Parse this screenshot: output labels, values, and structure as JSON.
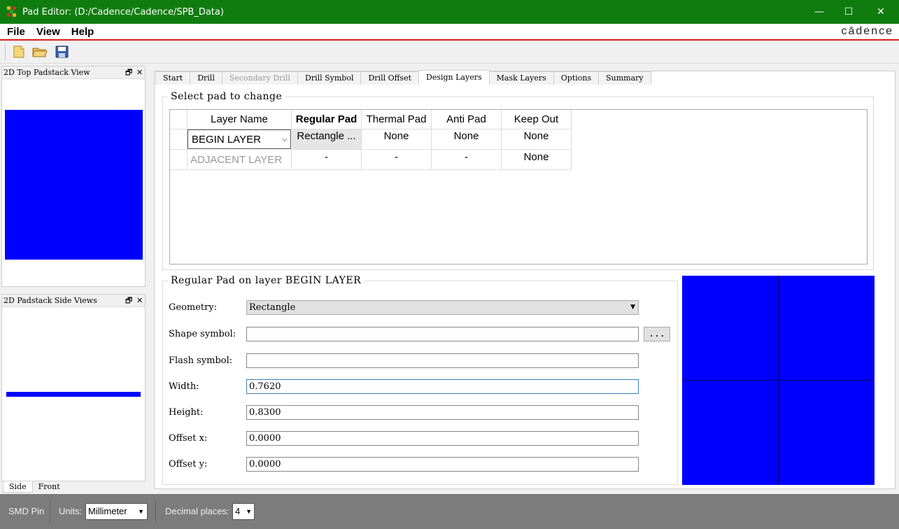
{
  "window": {
    "title": "Pad Editor:  (D:/Cadence/Cadence/SPB_Data)",
    "minimize": "—",
    "maximize": "☐",
    "close": "✕"
  },
  "menu": {
    "file": "File",
    "view": "View",
    "help": "Help",
    "brand": "cādence"
  },
  "panels": {
    "top_view_title": "2D Top Padstack View",
    "side_view_title": "2D Padstack Side Views",
    "float_glyph": "🗗",
    "close_glyph": "✕",
    "side_tab": "Side",
    "front_tab": "Front"
  },
  "tabs": [
    {
      "label": "Start"
    },
    {
      "label": "Drill"
    },
    {
      "label": "Secondary Drill"
    },
    {
      "label": "Drill Symbol"
    },
    {
      "label": "Drill Offset"
    },
    {
      "label": "Design Layers"
    },
    {
      "label": "Mask Layers"
    },
    {
      "label": "Options"
    },
    {
      "label": "Summary"
    }
  ],
  "select_pad": {
    "title": "Select pad to change",
    "columns": [
      "Layer Name",
      "Regular Pad",
      "Thermal Pad",
      "Anti Pad",
      "Keep Out"
    ],
    "rows": [
      {
        "layer": "BEGIN LAYER",
        "regular": "Rectangle ...",
        "thermal": "None",
        "anti": "None",
        "keepout": "None"
      },
      {
        "layer": "ADJACENT LAYER",
        "regular": "-",
        "thermal": "-",
        "anti": "-",
        "keepout": "None"
      }
    ]
  },
  "regular_pad": {
    "title": "Regular Pad on layer BEGIN LAYER",
    "geometry_label": "Geometry:",
    "geometry_value": "Rectangle",
    "shape_label": "Shape symbol:",
    "shape_value": "",
    "browse": "...",
    "flash_label": "Flash symbol:",
    "flash_value": "",
    "width_label": "Width:",
    "width_value": "0.7620",
    "height_label": "Height:",
    "height_value": "0.8300",
    "offx_label": "Offset x:",
    "offx_value": "0.0000",
    "offy_label": "Offset y:",
    "offy_value": "0.0000"
  },
  "status": {
    "pin_type": "SMD Pin",
    "units_label": "Units:",
    "units_value": "Millimeter",
    "decimal_label": "Decimal places:",
    "decimal_value": "4"
  },
  "colors": {
    "titlebar": "#107c10",
    "pad": "#0000ff",
    "accent_line": "#d42020"
  }
}
